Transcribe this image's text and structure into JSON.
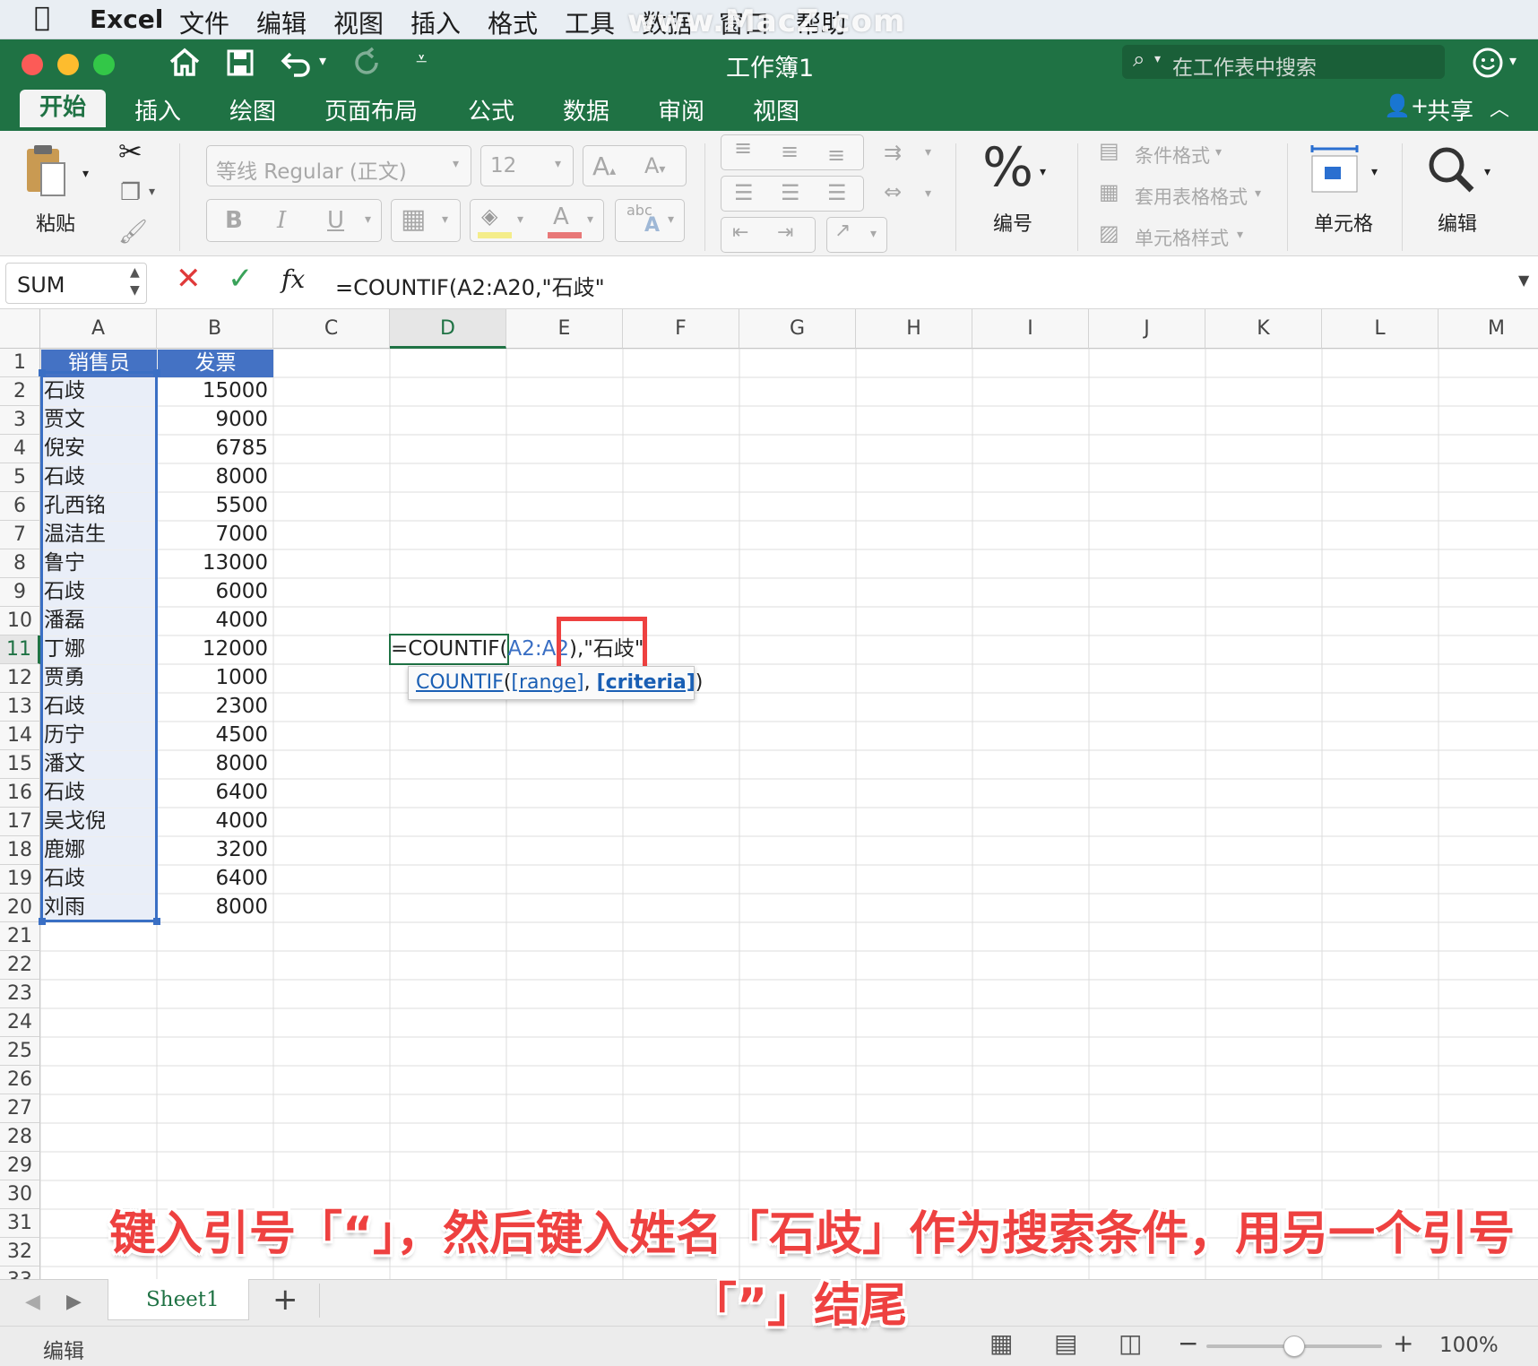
{
  "menubar": {
    "app": "Excel",
    "items": [
      "文件",
      "编辑",
      "视图",
      "插入",
      "格式",
      "工具",
      "数据",
      "窗口",
      "帮助"
    ],
    "watermark": "www.MacZ.com"
  },
  "titlebar": {
    "title": "工作簿1",
    "search_placeholder": "在工作表中搜索",
    "share": "共享"
  },
  "tabs": [
    "开始",
    "插入",
    "绘图",
    "页面布局",
    "公式",
    "数据",
    "审阅",
    "视图"
  ],
  "ribbon": {
    "paste": "粘贴",
    "font_name": "等线 Regular (正文)",
    "font_size": "12",
    "bold": "B",
    "italic": "I",
    "underline": "U",
    "number_symbol": "%",
    "number": "编号",
    "conditional_format": "条件格式",
    "table_format": "套用表格格式",
    "cell_styles": "单元格样式",
    "cells": "单元格",
    "editing": "编辑",
    "font_grow": "A",
    "font_shrink": "A",
    "font_color": "A",
    "abc": "abc"
  },
  "formula_bar": {
    "name_box": "SUM",
    "fx": "fx",
    "formula": "=COUNTIF(A2:A20,\"石歧\""
  },
  "columns": [
    "A",
    "B",
    "C",
    "D",
    "E",
    "F",
    "G",
    "H",
    "I",
    "J",
    "K",
    "L",
    "M"
  ],
  "table": {
    "headers": [
      "销售员",
      "发票"
    ],
    "rows": [
      [
        "石歧",
        "15000"
      ],
      [
        "贾文",
        "9000"
      ],
      [
        "倪安",
        "6785"
      ],
      [
        "石歧",
        "8000"
      ],
      [
        "孔西铭",
        "5500"
      ],
      [
        "温洁生",
        "7000"
      ],
      [
        "鲁宁",
        "13000"
      ],
      [
        "石歧",
        "6000"
      ],
      [
        "潘磊",
        "4000"
      ],
      [
        "丁娜",
        "12000"
      ],
      [
        "贾勇",
        "1000"
      ],
      [
        "石歧",
        "2300"
      ],
      [
        "历宁",
        "4500"
      ],
      [
        "潘文",
        "8000"
      ],
      [
        "石歧",
        "6400"
      ],
      [
        "吴戈倪",
        "4000"
      ],
      [
        "鹿娜",
        "3200"
      ],
      [
        "石歧",
        "6400"
      ],
      [
        "刘雨",
        "8000"
      ]
    ]
  },
  "active_cell": {
    "prefix": "=COUNTIF(",
    "range_ref": "A2:A2",
    "rest": "),\"石歧\""
  },
  "tooltip": {
    "func": "COUNTIF",
    "open": "(",
    "arg1": "[range]",
    "sep": ", ",
    "arg2": "[criteria]",
    "close": ")"
  },
  "sheets": {
    "tab": "Sheet1",
    "add": "+"
  },
  "status": {
    "mode": "编辑",
    "zoom": "100%"
  },
  "caption": {
    "line1": "键入引号「“」，然后键入姓名「石歧」作为搜索条件，用另一个引号",
    "line2": "「”」结尾"
  },
  "colors": {
    "excel_green": "#1f7244",
    "header_blue": "#4472c4",
    "highlight_red": "#ee4140",
    "range_blue": "#3a6fc4"
  }
}
